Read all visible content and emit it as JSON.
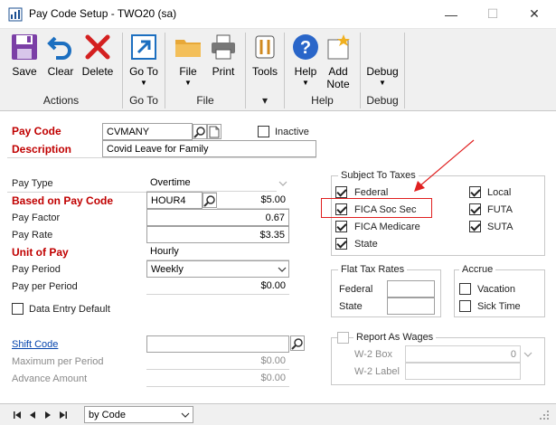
{
  "window": {
    "title": "Pay Code Setup  -  TWO20 (sa)",
    "minimize": "—",
    "maximize": "☐",
    "close": "✕"
  },
  "ribbon": {
    "save": "Save",
    "clear": "Clear",
    "delete": "Delete",
    "goto": "Go To",
    "file": "File",
    "print": "Print",
    "tools": "Tools",
    "help": "Help",
    "add_note_1": "Add",
    "add_note_2": "Note",
    "debug": "Debug",
    "groups": {
      "actions": "Actions",
      "goto": "Go To",
      "file": "File",
      "tools": "▾",
      "help": "Help",
      "debug": "Debug"
    }
  },
  "form": {
    "pay_code_label": "Pay Code",
    "pay_code_value": "CVMANY",
    "inactive_label": "Inactive",
    "description_label": "Description",
    "description_value": "Covid Leave for Family",
    "pay_type_label": "Pay Type",
    "pay_type_value": "Overtime",
    "based_on_label": "Based on Pay Code",
    "based_on_value": "HOUR4",
    "based_on_amount": "$5.00",
    "pay_factor_label": "Pay Factor",
    "pay_factor_value": "0.67",
    "pay_rate_label": "Pay Rate",
    "pay_rate_value": "$3.35",
    "unit_label": "Unit of Pay",
    "unit_value": "Hourly",
    "pay_period_label": "Pay Period",
    "pay_period_value": "Weekly",
    "pay_per_period_label": "Pay per Period",
    "pay_per_period_value": "$0.00",
    "data_entry_label": "Data Entry Default",
    "shift_code_label": "Shift Code",
    "max_per_period_label": "Maximum per Period",
    "max_per_period_value": "$0.00",
    "advance_label": "Advance Amount",
    "advance_value": "$0.00"
  },
  "taxes": {
    "title": "Subject To Taxes",
    "federal": "Federal",
    "fica_ss": "FICA Soc Sec",
    "fica_med": "FICA Medicare",
    "state": "State",
    "local": "Local",
    "futa": "FUTA",
    "suta": "SUTA"
  },
  "flat": {
    "title": "Flat Tax Rates",
    "federal": "Federal",
    "state": "State"
  },
  "accrue": {
    "title": "Accrue",
    "vacation": "Vacation",
    "sick": "Sick Time"
  },
  "wages": {
    "title": "Report As Wages",
    "w2box": "W-2 Box",
    "w2box_value": "0",
    "w2label": "W-2 Label"
  },
  "status": {
    "sort": "by Code"
  },
  "colors": {
    "accent": "#c00000",
    "annotation": "#e02020",
    "link": "#0645ad"
  }
}
